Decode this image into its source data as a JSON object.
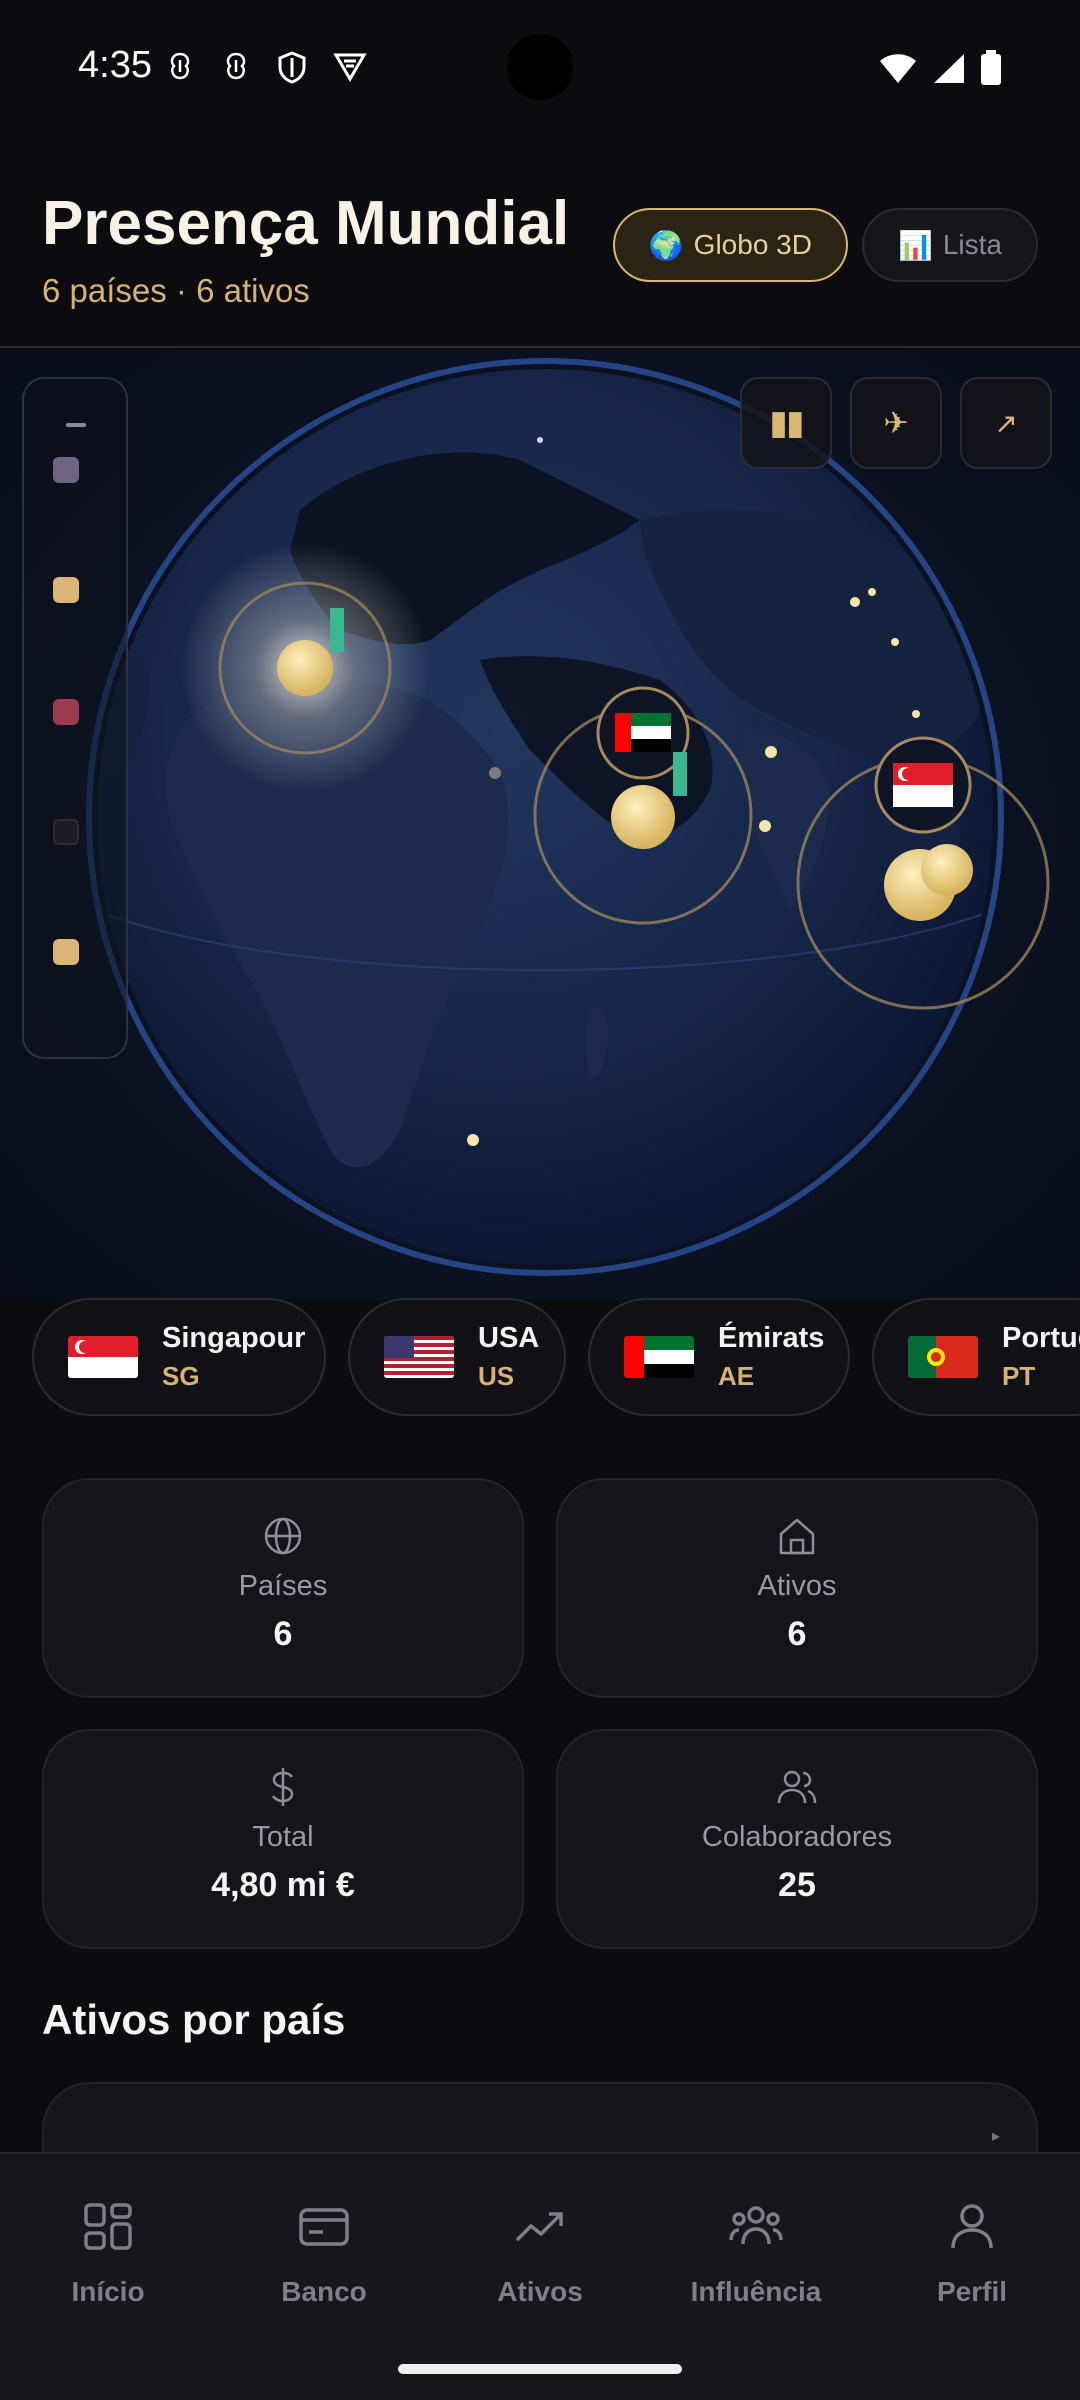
{
  "status_bar": {
    "time": "4:35",
    "left_icons": [
      "notification-icon",
      "notification-icon",
      "shield-icon",
      "vpn-icon"
    ],
    "right_icons": [
      "wifi-icon",
      "signal-icon",
      "battery-icon"
    ]
  },
  "header": {
    "title": "Presença Mundial",
    "subtitle": "6 países · 6 ativos",
    "toggle": [
      {
        "icon": "🌍",
        "label": "Globo 3D",
        "active": true
      },
      {
        "icon": "📊",
        "label": "Lista",
        "active": false
      }
    ]
  },
  "globe": {
    "controls": [
      {
        "icon": "pause-icon",
        "glyph": "▮▮"
      },
      {
        "icon": "plane-icon",
        "glyph": "✈"
      },
      {
        "icon": "expand-icon",
        "glyph": "↗"
      }
    ],
    "legend_colors": [
      "#6e6585",
      "#d9b676",
      "#9c3a4f",
      "#1c1c22",
      "#d9b676"
    ],
    "markers": [
      {
        "country": "Portugal",
        "flag": "pt"
      },
      {
        "country": "Émirats",
        "flag": "ae"
      },
      {
        "country": "Singapour",
        "flag": "sg"
      }
    ]
  },
  "countries": [
    {
      "name": "Singapour",
      "code": "SG",
      "flag": "sg"
    },
    {
      "name": "USA",
      "code": "US",
      "flag": "us"
    },
    {
      "name": "Émirats",
      "code": "AE",
      "flag": "ae"
    },
    {
      "name": "Portugal",
      "code": "PT",
      "flag": "pt"
    }
  ],
  "stats": [
    {
      "icon": "globe-icon",
      "label": "Países",
      "value": "6"
    },
    {
      "icon": "building-icon",
      "label": "Ativos",
      "value": "6"
    },
    {
      "icon": "dollar-icon",
      "label": "Total",
      "value": "4,80 mi €"
    },
    {
      "icon": "users-icon",
      "label": "Colaboradores",
      "value": "25"
    }
  ],
  "assets_section": {
    "title": "Ativos por país"
  },
  "bottom_nav": [
    {
      "icon": "grid-icon",
      "label": "Início"
    },
    {
      "icon": "card-icon",
      "label": "Banco"
    },
    {
      "icon": "trend-icon",
      "label": "Ativos"
    },
    {
      "icon": "people-icon",
      "label": "Influência"
    },
    {
      "icon": "profile-icon",
      "label": "Perfil"
    }
  ],
  "colors": {
    "accent_gold": "#d9b676",
    "background": "#0b0b10",
    "card": "#14141b"
  }
}
